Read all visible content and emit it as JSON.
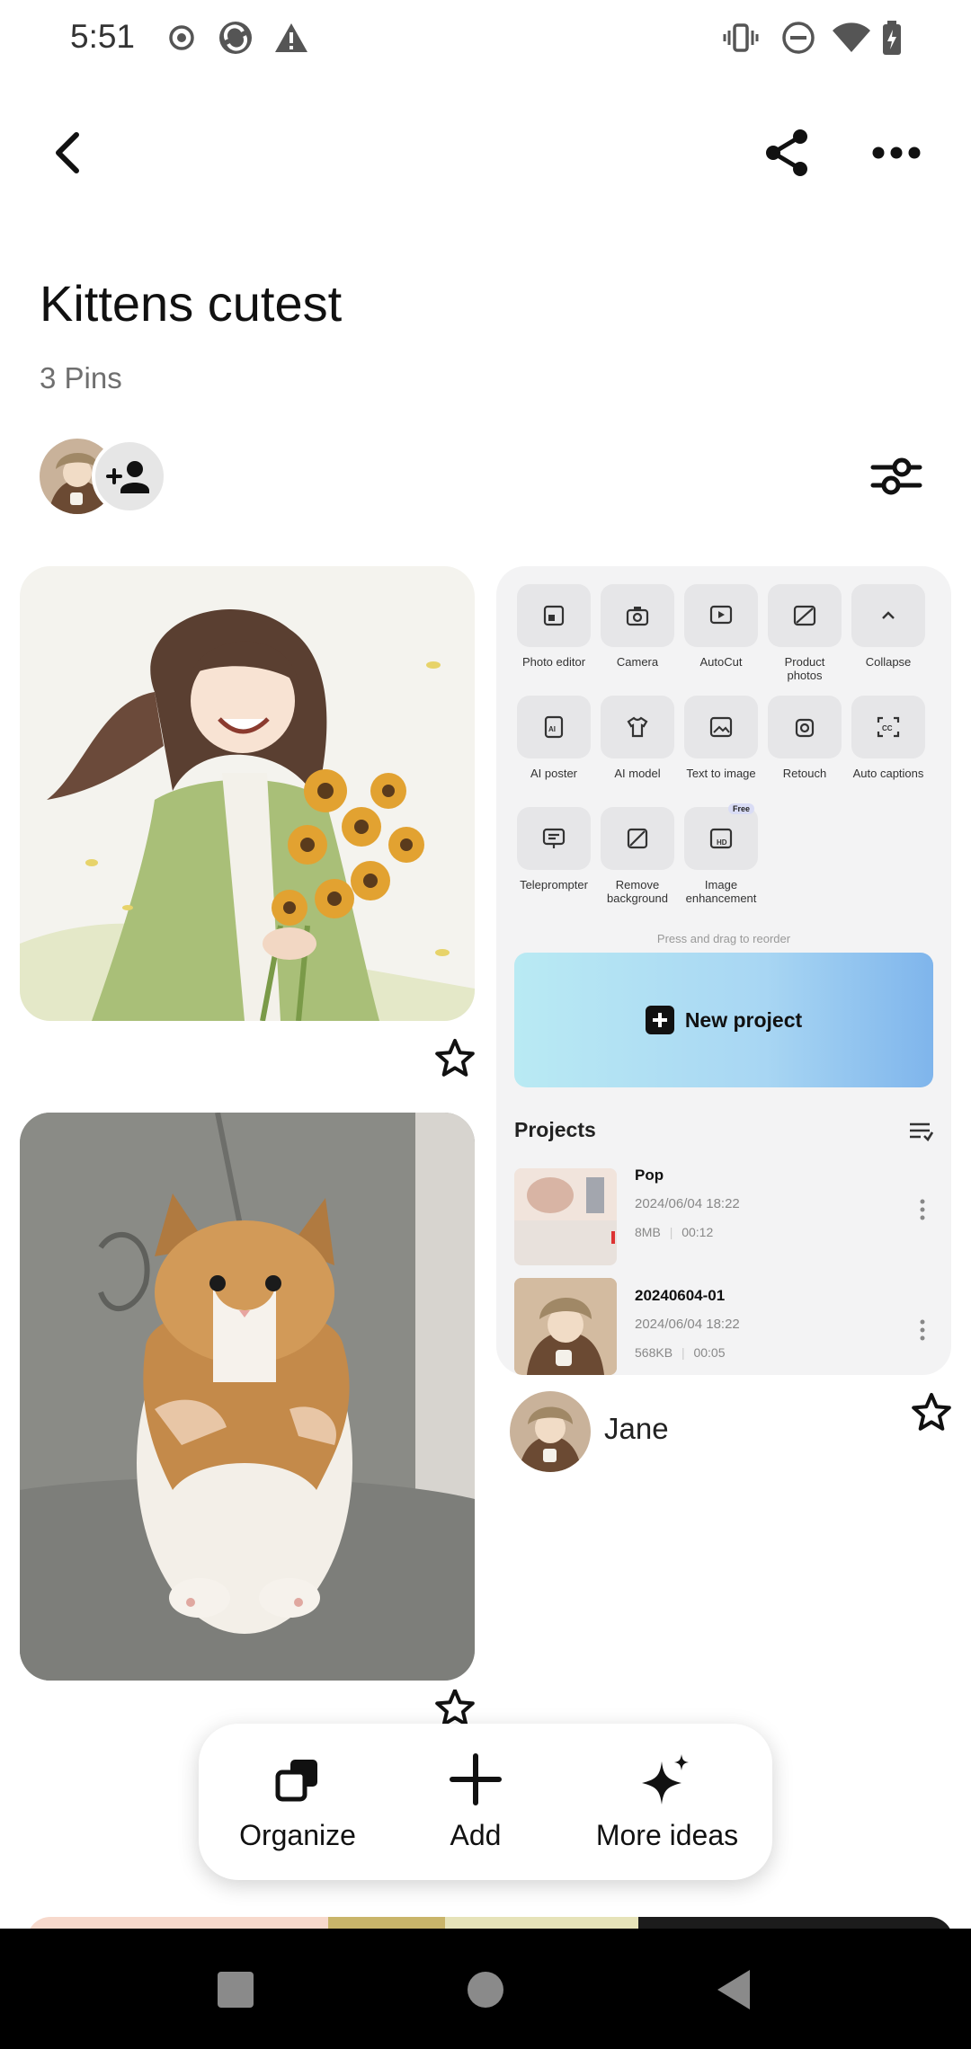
{
  "status_bar": {
    "time": "5:51",
    "left_icons": [
      "record-icon",
      "sync-app-icon",
      "warning-icon"
    ],
    "right_icons": [
      "vibrate-icon",
      "do-not-disturb-icon",
      "wifi-icon",
      "battery-charging-icon"
    ]
  },
  "header": {
    "back_icon": "chevron-left-icon",
    "share_icon": "share-icon",
    "more_icon": "more-horizontal-icon"
  },
  "board": {
    "title": "Kittens cutest",
    "pin_count": "3 Pins",
    "collaborator_icon": "add-person-icon",
    "filter_icon": "sliders-icon"
  },
  "pins": {
    "first_pin_alt": "anime girl with sunflowers",
    "second_pin_alt": "fluffy cat held in arms",
    "saved_icon": "star-outline-icon"
  },
  "app_screenshot": {
    "tools": [
      {
        "label": "Photo editor",
        "icon": "photo-editor-icon"
      },
      {
        "label": "Camera",
        "icon": "camera-icon"
      },
      {
        "label": "AutoCut",
        "icon": "autocut-icon"
      },
      {
        "label": "Product photos",
        "icon": "product-photos-icon"
      },
      {
        "label": "Collapse",
        "icon": "chevron-up-icon"
      },
      {
        "label": "AI poster",
        "icon": "ai-poster-icon"
      },
      {
        "label": "AI model",
        "icon": "ai-model-icon"
      },
      {
        "label": "Text to image",
        "icon": "text-to-image-icon"
      },
      {
        "label": "Retouch",
        "icon": "retouch-icon"
      },
      {
        "label": "Auto captions",
        "icon": "captions-icon"
      },
      {
        "label": "Teleprompter",
        "icon": "teleprompter-icon"
      },
      {
        "label": "Remove background",
        "icon": "remove-background-icon"
      },
      {
        "label": "Image enhancement",
        "icon": "hd-icon",
        "badge": "Free"
      }
    ],
    "reorder_hint": "Press and drag to reorder",
    "new_project_label": "New project",
    "projects_heading": "Projects",
    "projects": [
      {
        "name": "Pop",
        "date": "2024/06/04 18:22",
        "size": "8MB",
        "duration": "00:12"
      },
      {
        "name": "20240604-01",
        "date": "2024/06/04 18:22",
        "size": "568KB",
        "duration": "00:05"
      }
    ]
  },
  "author": {
    "name": "Jane"
  },
  "action_bar": {
    "organize": "Organize",
    "add": "Add",
    "more_ideas": "More ideas"
  },
  "nav_bar": {
    "icons": [
      "recents-square-icon",
      "home-circle-icon",
      "back-triangle-icon"
    ]
  },
  "colors": {
    "accent_gradient_start": "#b9eaf3",
    "accent_gradient_end": "#7fb5ec",
    "nav_background": "#000000"
  }
}
